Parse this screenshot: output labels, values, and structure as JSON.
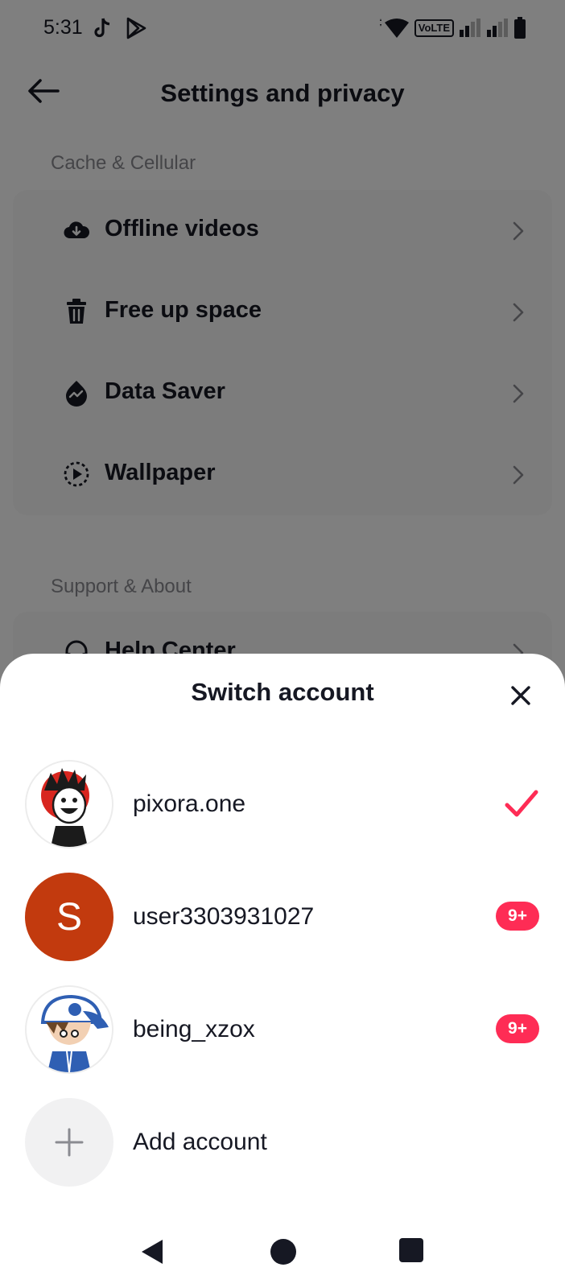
{
  "status_bar": {
    "time": "5:31",
    "network_label": "VoLTE"
  },
  "settings": {
    "title": "Settings and privacy",
    "sections": [
      {
        "header": "Cache & Cellular",
        "items": [
          {
            "label": "Offline videos",
            "icon": "cloud-download-icon"
          },
          {
            "label": "Free up space",
            "icon": "trash-icon"
          },
          {
            "label": "Data Saver",
            "icon": "data-saver-icon"
          },
          {
            "label": "Wallpaper",
            "icon": "wallpaper-icon"
          }
        ]
      },
      {
        "header": "Support & About",
        "items": [
          {
            "label": "Help Center",
            "icon": "headset-icon"
          }
        ]
      }
    ]
  },
  "switch_account": {
    "title": "Switch account",
    "accounts": [
      {
        "name": "pixora.one",
        "selected": true
      },
      {
        "name": "user3303931027",
        "avatar_letter": "S",
        "badge": "9+"
      },
      {
        "name": "being_xzox",
        "badge": "9+"
      }
    ],
    "add_label": "Add account"
  },
  "colors": {
    "accent": "#fe2c55",
    "letter_avatar_bg": "#c23a0e"
  }
}
